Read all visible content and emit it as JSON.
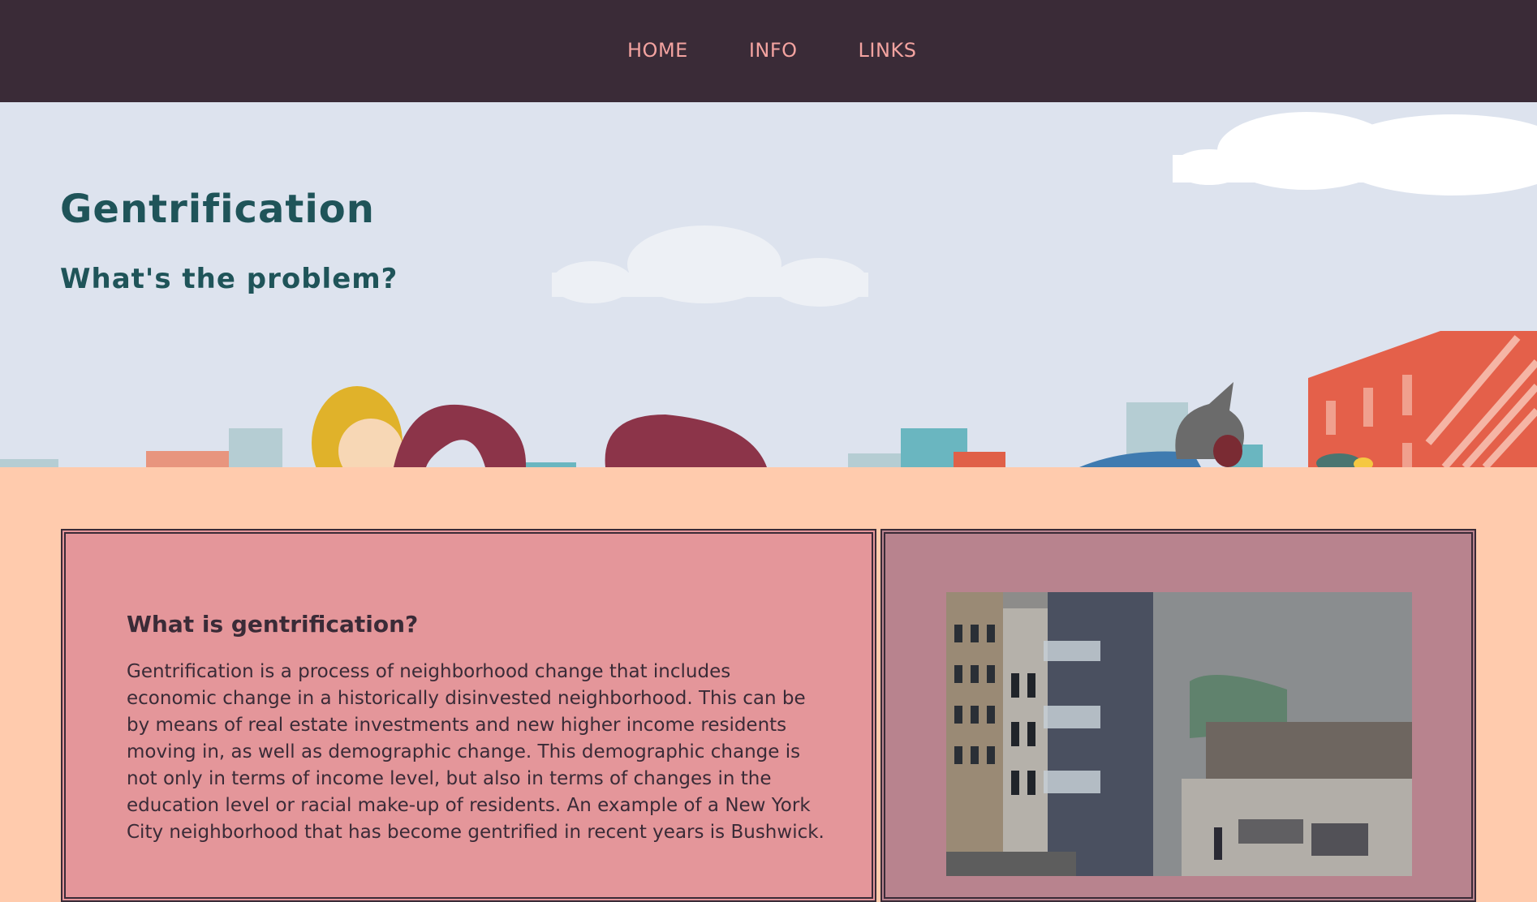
{
  "nav": {
    "items": [
      {
        "label": "HOME"
      },
      {
        "label": "INFO"
      },
      {
        "label": "LINKS"
      }
    ],
    "link_color": "#f3a3a0",
    "background": "#3a2b37"
  },
  "hero": {
    "title": "Gentrification",
    "subtitle": "What's the problem?",
    "background": "#dde3ee"
  },
  "article": {
    "heading": "What is gentrification?",
    "body": "Gentrification is a process of neighborhood change that includes economic change in a historically disinvested neighborhood. This can be by means of real estate investments and new higher income residents moving in, as well as demographic change. This demographic change is not only in terms of income level, but also in terms of changes in the education level or racial make-up of residents. An example of a New York City neighborhood that has become gentrified in recent years is Bushwick."
  },
  "colors": {
    "page_background": "#ffcbad",
    "card_left": "#e4969a",
    "card_right": "#b8838e",
    "title_color": "#1f5459"
  }
}
